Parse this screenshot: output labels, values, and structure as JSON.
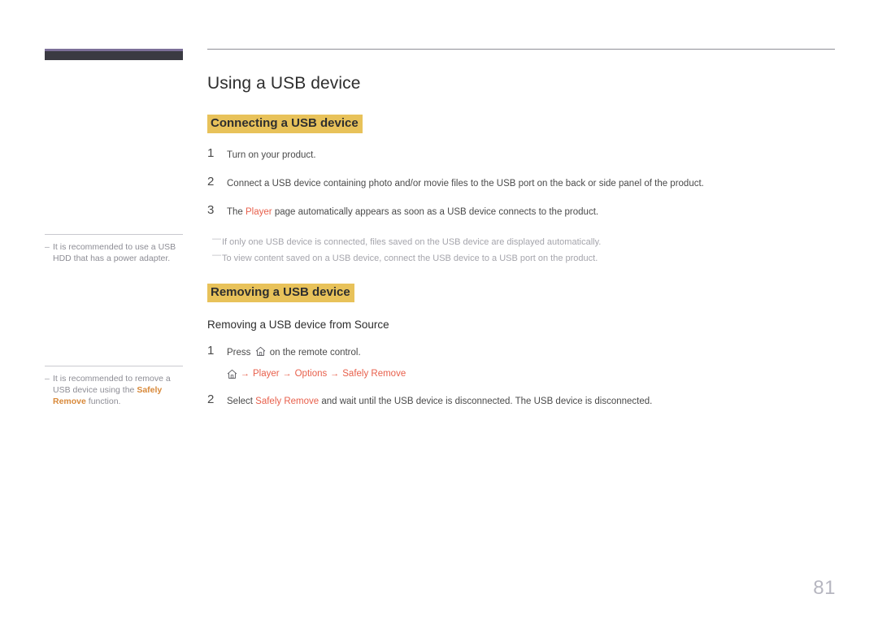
{
  "document": {
    "page_number": "81"
  },
  "colors": {
    "accent_red": "#e8604c",
    "highlight_band": "#e8c25a",
    "chapter_bar": "#3a3a42",
    "chapter_bar_top": "#7c6f99",
    "note_gray": "#a5a5ac",
    "page_number": "#b6b6c0"
  },
  "sidebar": {
    "notes": [
      {
        "dash": "–",
        "text_before": "It is recommended to use a USB HDD that has a power adapter.",
        "highlight": "",
        "text_after": ""
      },
      {
        "dash": "–",
        "text_before": "It is recommended to remove a USB device using the ",
        "highlight": "Safely Remove",
        "text_after": " function."
      }
    ]
  },
  "main": {
    "title": "Using a USB device",
    "sections": [
      {
        "band_label": "Connecting a USB device",
        "steps": [
          {
            "number": "1",
            "text_before": "Turn on your product.",
            "accent": "",
            "text_after": ""
          },
          {
            "number": "2",
            "text_before": "Connect a USB device containing photo and/or movie files to the USB port on the back or side panel of the product.",
            "accent": "",
            "text_after": ""
          },
          {
            "number": "3",
            "text_before": "The ",
            "accent": "Player",
            "text_after": " page automatically appears as soon as a USB device connects to the product."
          }
        ],
        "notes": [
          {
            "dash": "—",
            "text": "If only one USB device is connected, files saved on the USB device are displayed automatically."
          },
          {
            "dash": "—",
            "text": "To view content saved on a USB device, connect the USB device to a USB port on the product."
          }
        ]
      },
      {
        "band_label": "Removing a USB device",
        "sub_heading": "Removing a USB device from Source",
        "steps": [
          {
            "number": "1",
            "text_before": "Press ",
            "icon": "home-icon",
            "text_after": " on the remote control."
          },
          {
            "number": "2",
            "text_before": "Select ",
            "accent": "Safely Remove",
            "text_after": " and wait until the USB device is disconnected. The USB device is disconnected."
          }
        ],
        "path": {
          "home_icon": "home-icon",
          "arrow": "→",
          "segments": [
            "Player",
            "Options",
            "Safely Remove"
          ]
        }
      }
    ]
  }
}
